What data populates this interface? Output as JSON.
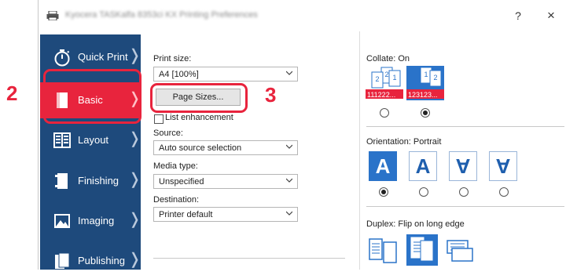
{
  "window": {
    "title": "Kyocera TASKalfa 8353ci KX Printing Preferences",
    "help": "?",
    "close": "×"
  },
  "callouts": {
    "step2": "2",
    "step3": "3"
  },
  "sidebar": {
    "items": [
      {
        "label": "Quick Print",
        "icon": "stopwatch-icon"
      },
      {
        "label": "Basic",
        "icon": "page-icon",
        "active": true
      },
      {
        "label": "Layout",
        "icon": "layout-grid-icon"
      },
      {
        "label": "Finishing",
        "icon": "finishing-icon"
      },
      {
        "label": "Imaging",
        "icon": "picture-icon"
      },
      {
        "label": "Publishing",
        "icon": "publishing-icon"
      }
    ]
  },
  "left": {
    "print_size_label": "Print size:",
    "print_size_value": "A4 [100%]",
    "page_sizes_button": "Page Sizes...",
    "list_enhancement_label": "List enhancement",
    "source_label": "Source:",
    "source_value": "Auto source selection",
    "media_type_label": "Media type:",
    "media_type_value": "Unspecified",
    "destination_label": "Destination:",
    "destination_value": "Printer default"
  },
  "right": {
    "collate_label": "Collate:  On",
    "collate_off_text": "111222...",
    "collate_on_text": "123123...",
    "orientation_label": "Orientation:  Portrait",
    "orientation_glyph": "A",
    "duplex_label": "Duplex:  Flip on long edge"
  },
  "colors": {
    "sidebar_bg": "#1e4a7c",
    "active_item": "#e8243d",
    "callout": "#e8243d",
    "selection_blue": "#2a73c9"
  }
}
